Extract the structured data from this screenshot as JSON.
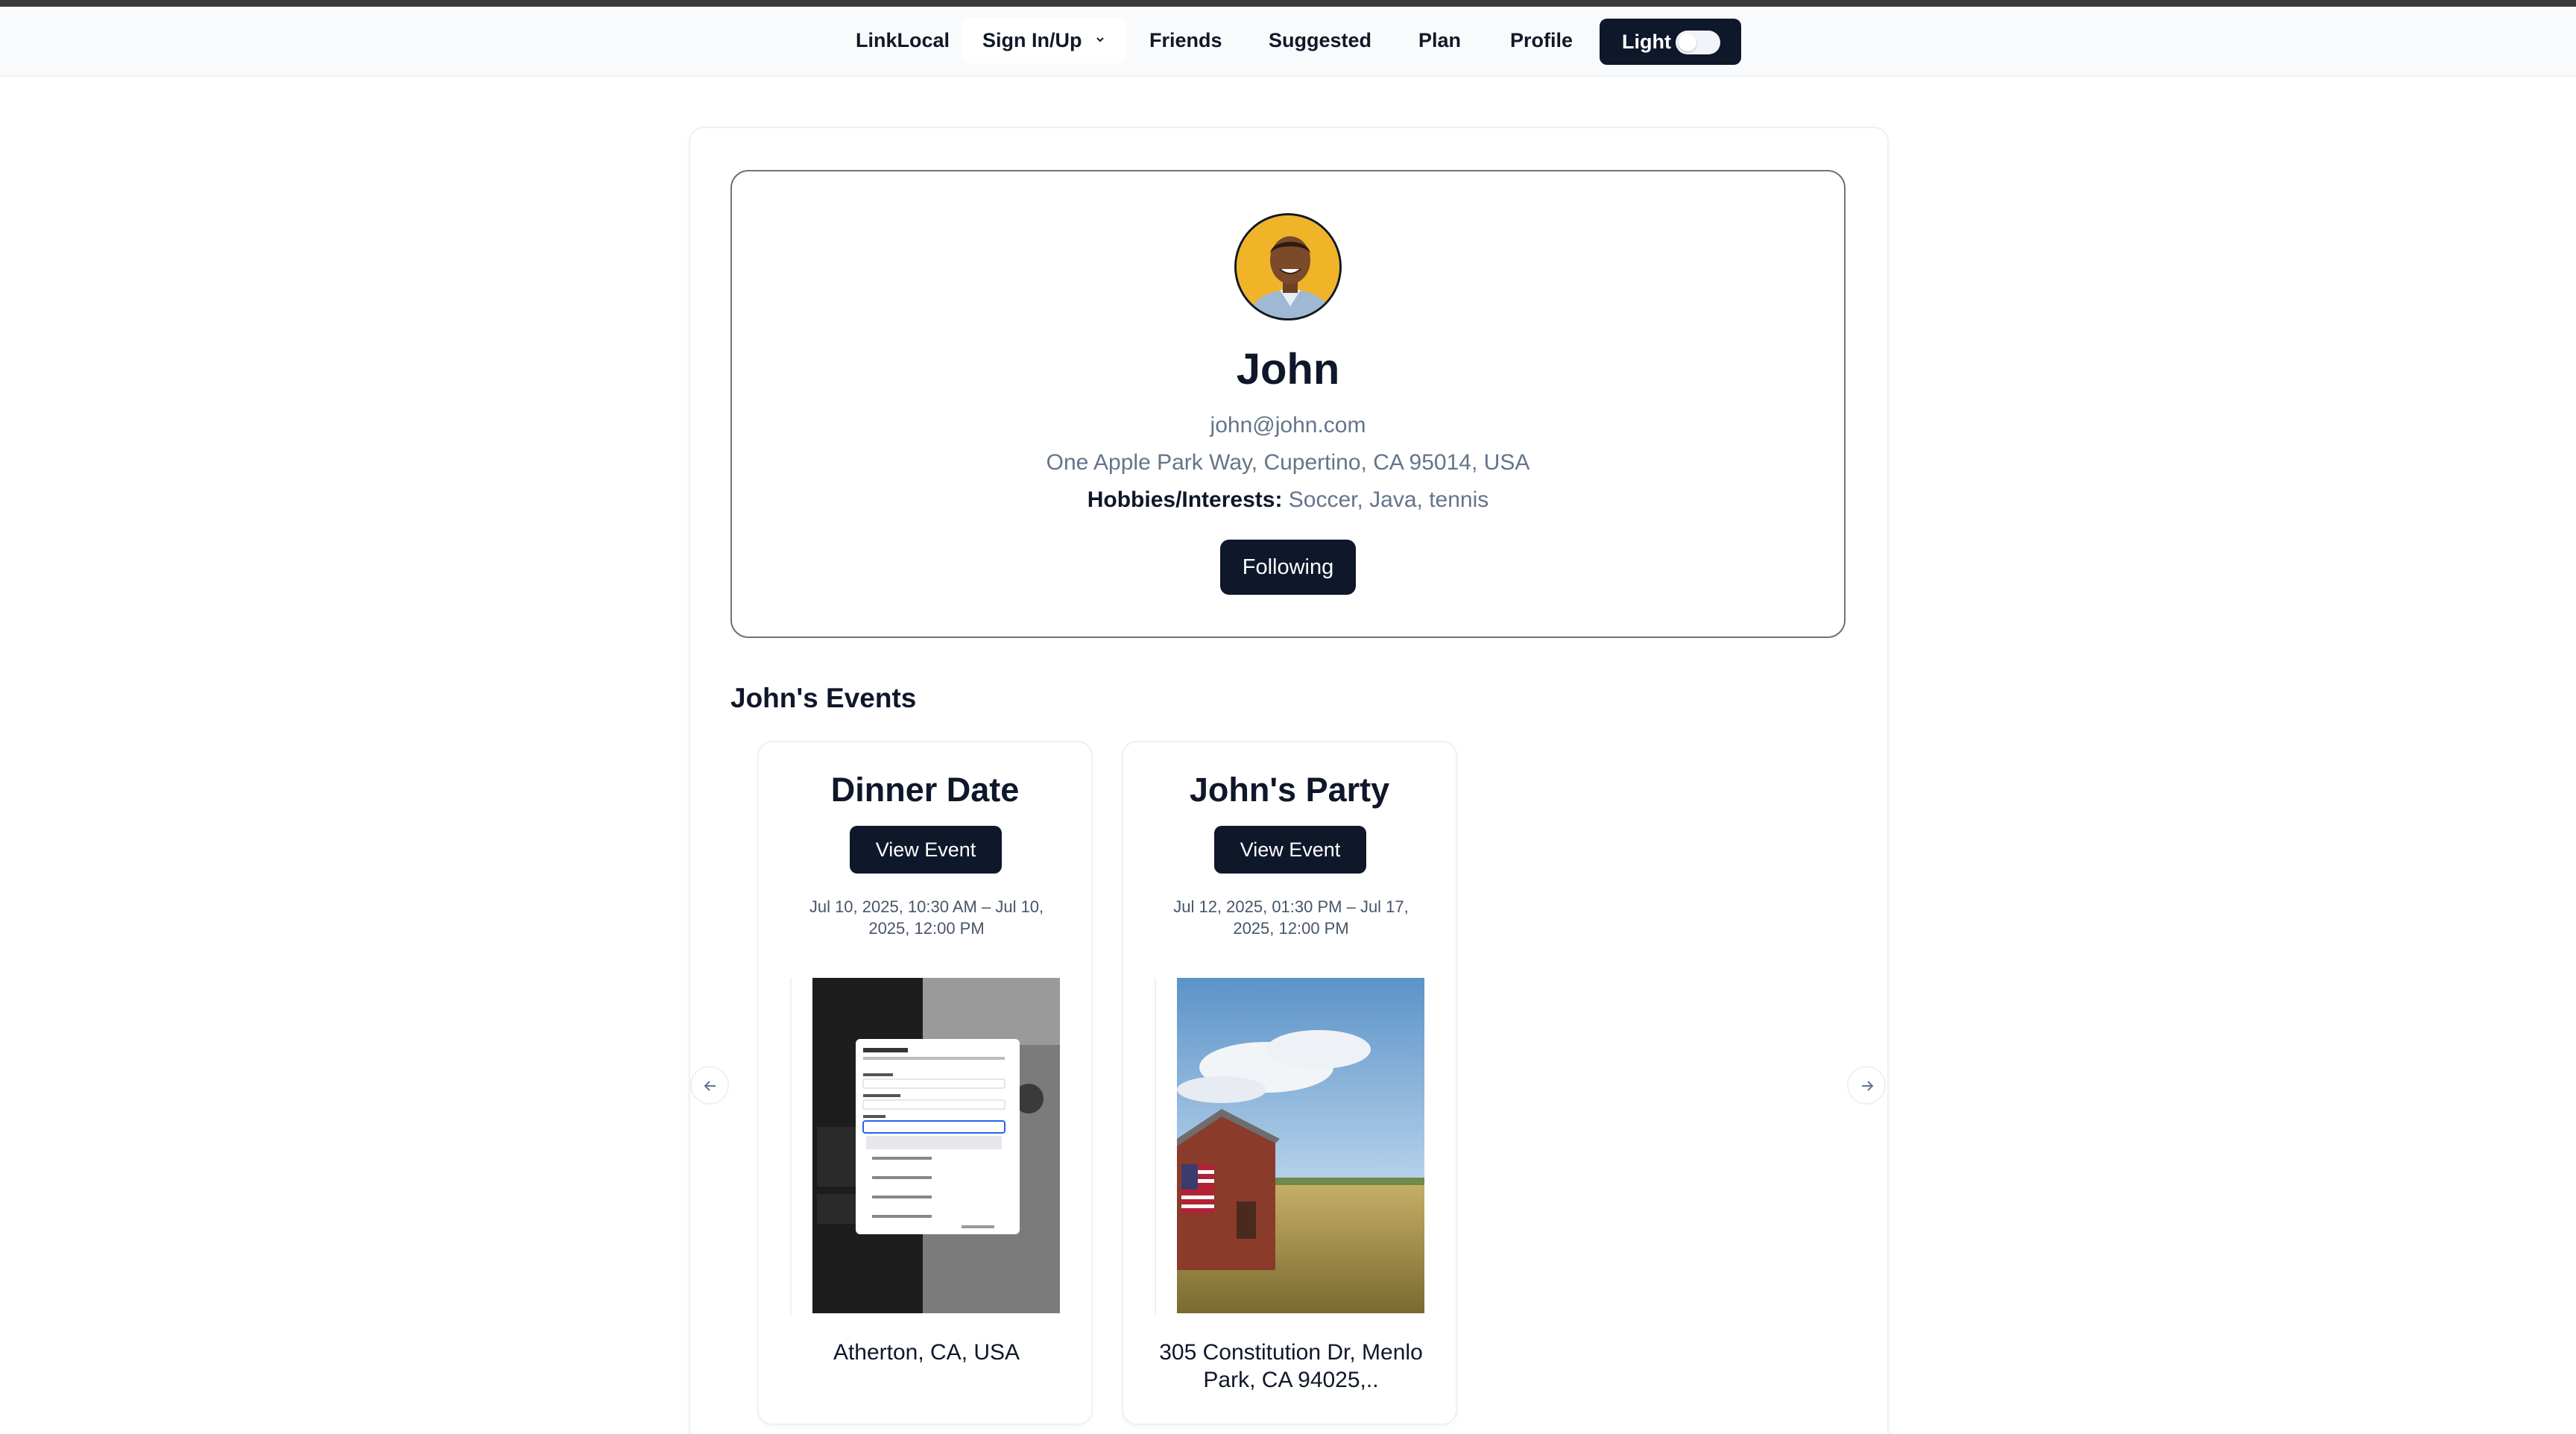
{
  "nav": {
    "brand": "LinkLocal",
    "sign_in": "Sign In/Up",
    "friends": "Friends",
    "suggested": "Suggested",
    "plan": "Plan",
    "profile": "Profile",
    "theme_label": "Light"
  },
  "profile": {
    "name": "John",
    "email": "john@john.com",
    "address": "One Apple Park Way, Cupertino, CA 95014, USA",
    "hobbies_label": "Hobbies/Interests:",
    "hobbies_value": "Soccer, Java, tennis",
    "follow_button": "Following"
  },
  "events": {
    "heading": "John's Events",
    "items": [
      {
        "title": "Dinner Date",
        "button": "View Event",
        "date": "Jul 10, 2025, 10:30 AM – Jul 10, 2025, 12:00 PM",
        "location": "Atherton, CA, USA"
      },
      {
        "title": "John's Party",
        "button": "View Event",
        "date": "Jul 12, 2025, 01:30 PM – Jul 17, 2025, 12:00 PM",
        "location": "305 Constitution Dr, Menlo Park, CA 94025,.."
      }
    ]
  },
  "colors": {
    "primary": "#0f172a",
    "muted_text": "#64748b",
    "border": "#eef0f3",
    "avatar_bg": "#f0b429"
  },
  "icons": {
    "chevron": "chevron-down-icon",
    "prev": "arrow-left-icon",
    "next": "arrow-right-icon"
  }
}
